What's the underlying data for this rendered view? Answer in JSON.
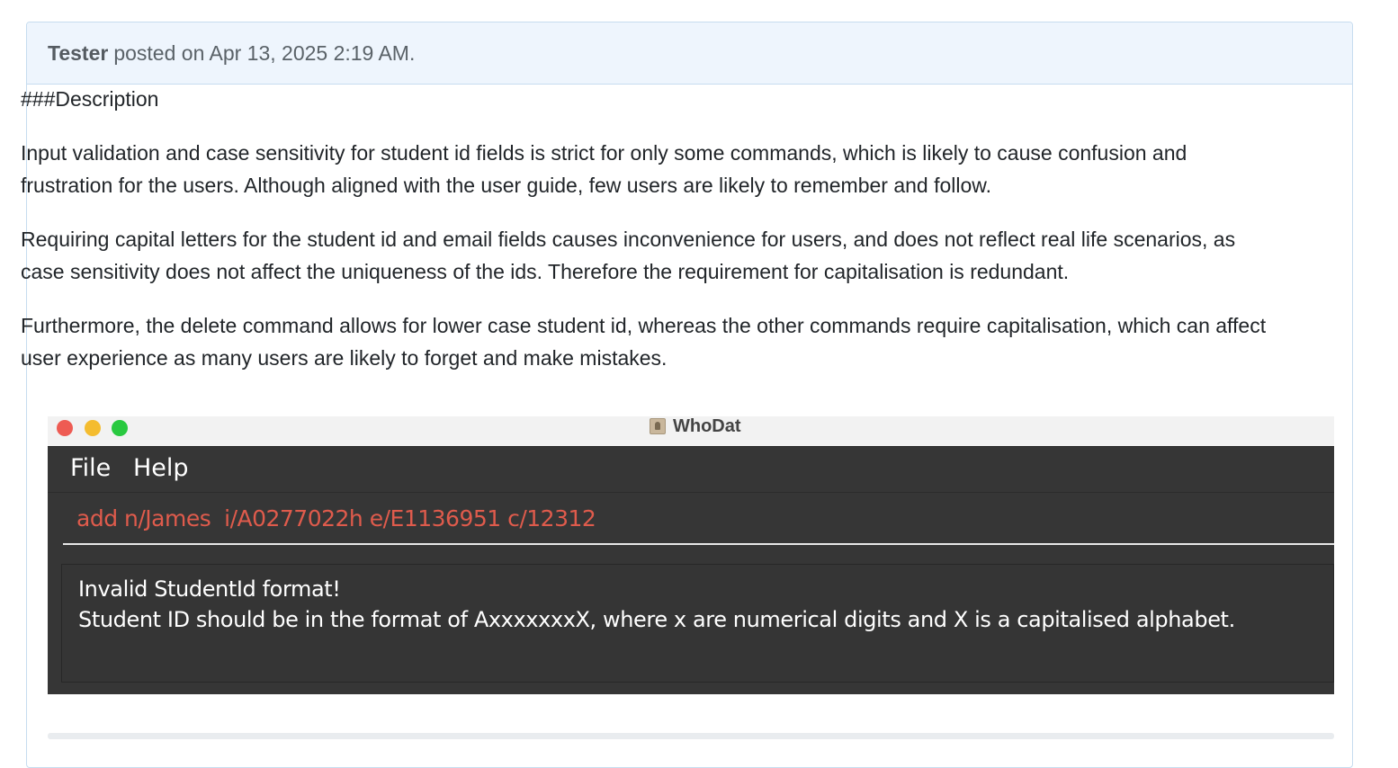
{
  "post": {
    "author": "Tester",
    "meta": "posted on Apr 13, 2025 2:19 AM."
  },
  "content": {
    "heading": "###Description",
    "paragraphs": [
      "Input validation and case sensitivity for student id fields is strict for only some commands, which is likely to cause confusion and frustration for the users. Although aligned with the user guide, few users are likely to remember and follow.",
      "Requiring capital letters for the student id and email fields causes inconvenience for users, and does not reflect real life scenarios, as case sensitivity does not affect the uniqueness of the ids. Therefore the requirement for capitalisation is redundant.",
      "Furthermore, the delete command allows for lower case student id, whereas the other commands require capitalisation, which can affect user experience as many users are likely to forget and make mistakes."
    ]
  },
  "screenshot": {
    "window_title": "WhoDat",
    "menu": {
      "file": "File",
      "help": "Help"
    },
    "command_value": "add n/James  i/A0277022h e/E1136951 c/12312",
    "result_lines": [
      "Invalid StudentId format!",
      "Student ID should be in the format of AxxxxxxxX, where x are numerical digits and X is a capitalised alphabet."
    ],
    "colors": {
      "window_bg": "#363636",
      "command_error_text": "#df5b4c",
      "traffic_red": "#ee5b53",
      "traffic_yellow": "#f4bc2f",
      "traffic_green": "#29c940"
    }
  }
}
